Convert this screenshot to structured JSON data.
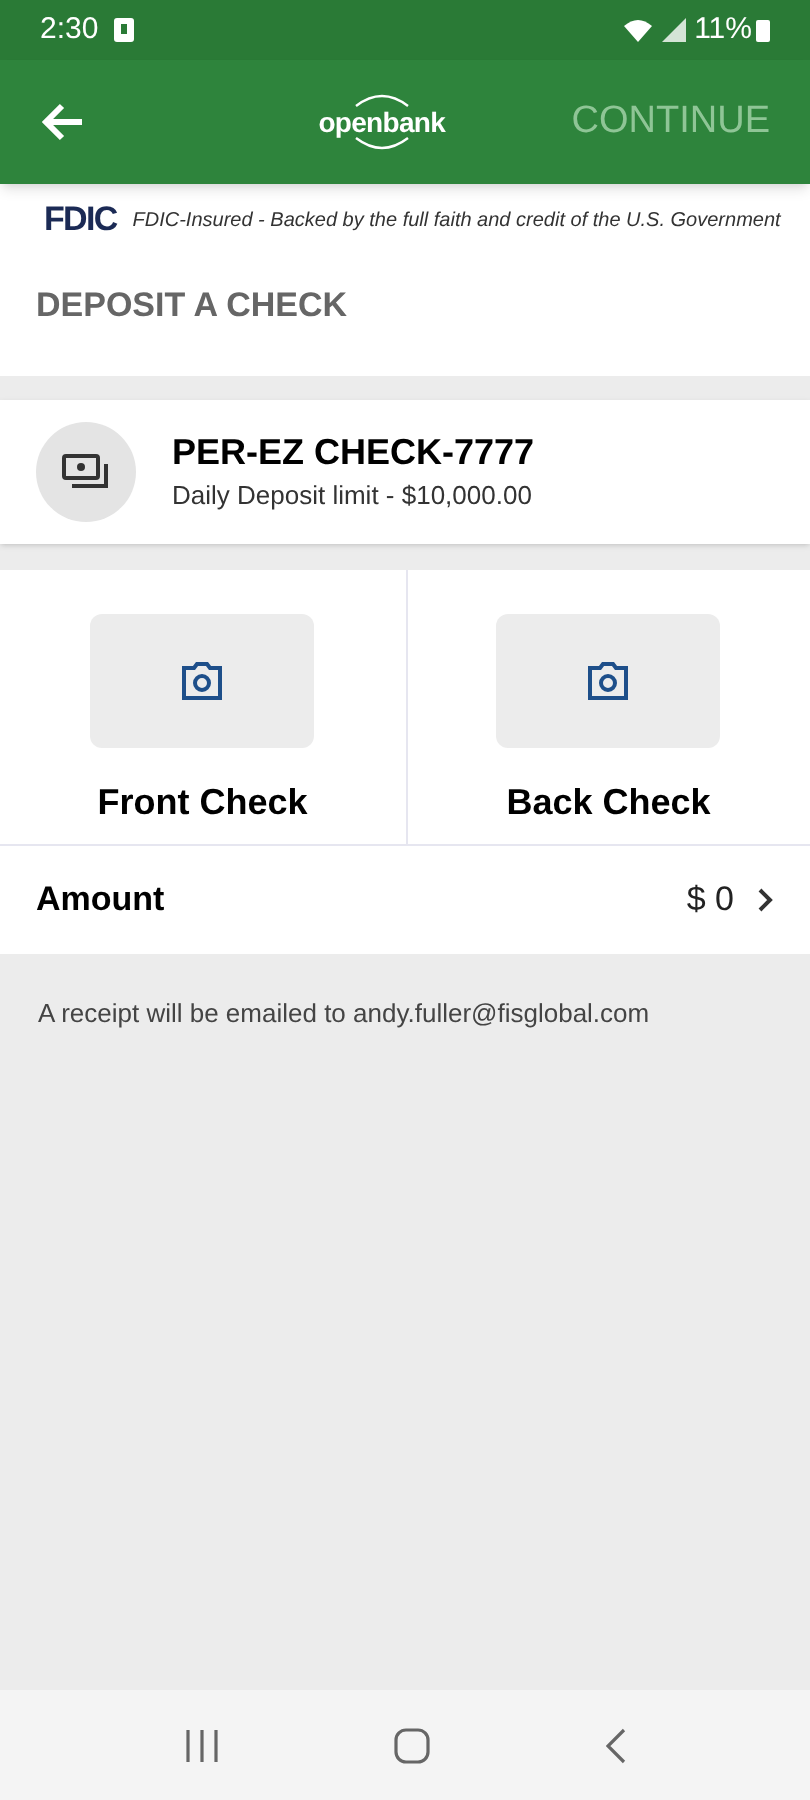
{
  "status_bar": {
    "time": "2:30",
    "battery": "11%"
  },
  "app_bar": {
    "logo": "openbank",
    "continue_button": {
      "label": "CONTINUE",
      "disabled": true
    }
  },
  "fdic": {
    "logo": "FDIC",
    "notice": "FDIC-Insured - Backed by the full faith and credit of the U.S. Government"
  },
  "page_title": "DEPOSIT A CHECK",
  "account": {
    "name": "PER-EZ CHECK-7777",
    "limit": "Daily Deposit limit - $10,000.00"
  },
  "captures": [
    {
      "label": "Front Check"
    },
    {
      "label": "Back Check"
    }
  ],
  "amount": {
    "label": "Amount",
    "value": "$ 0"
  },
  "receipt_note": "A receipt will be emailed to andy.fuller@fisglobal.com"
}
